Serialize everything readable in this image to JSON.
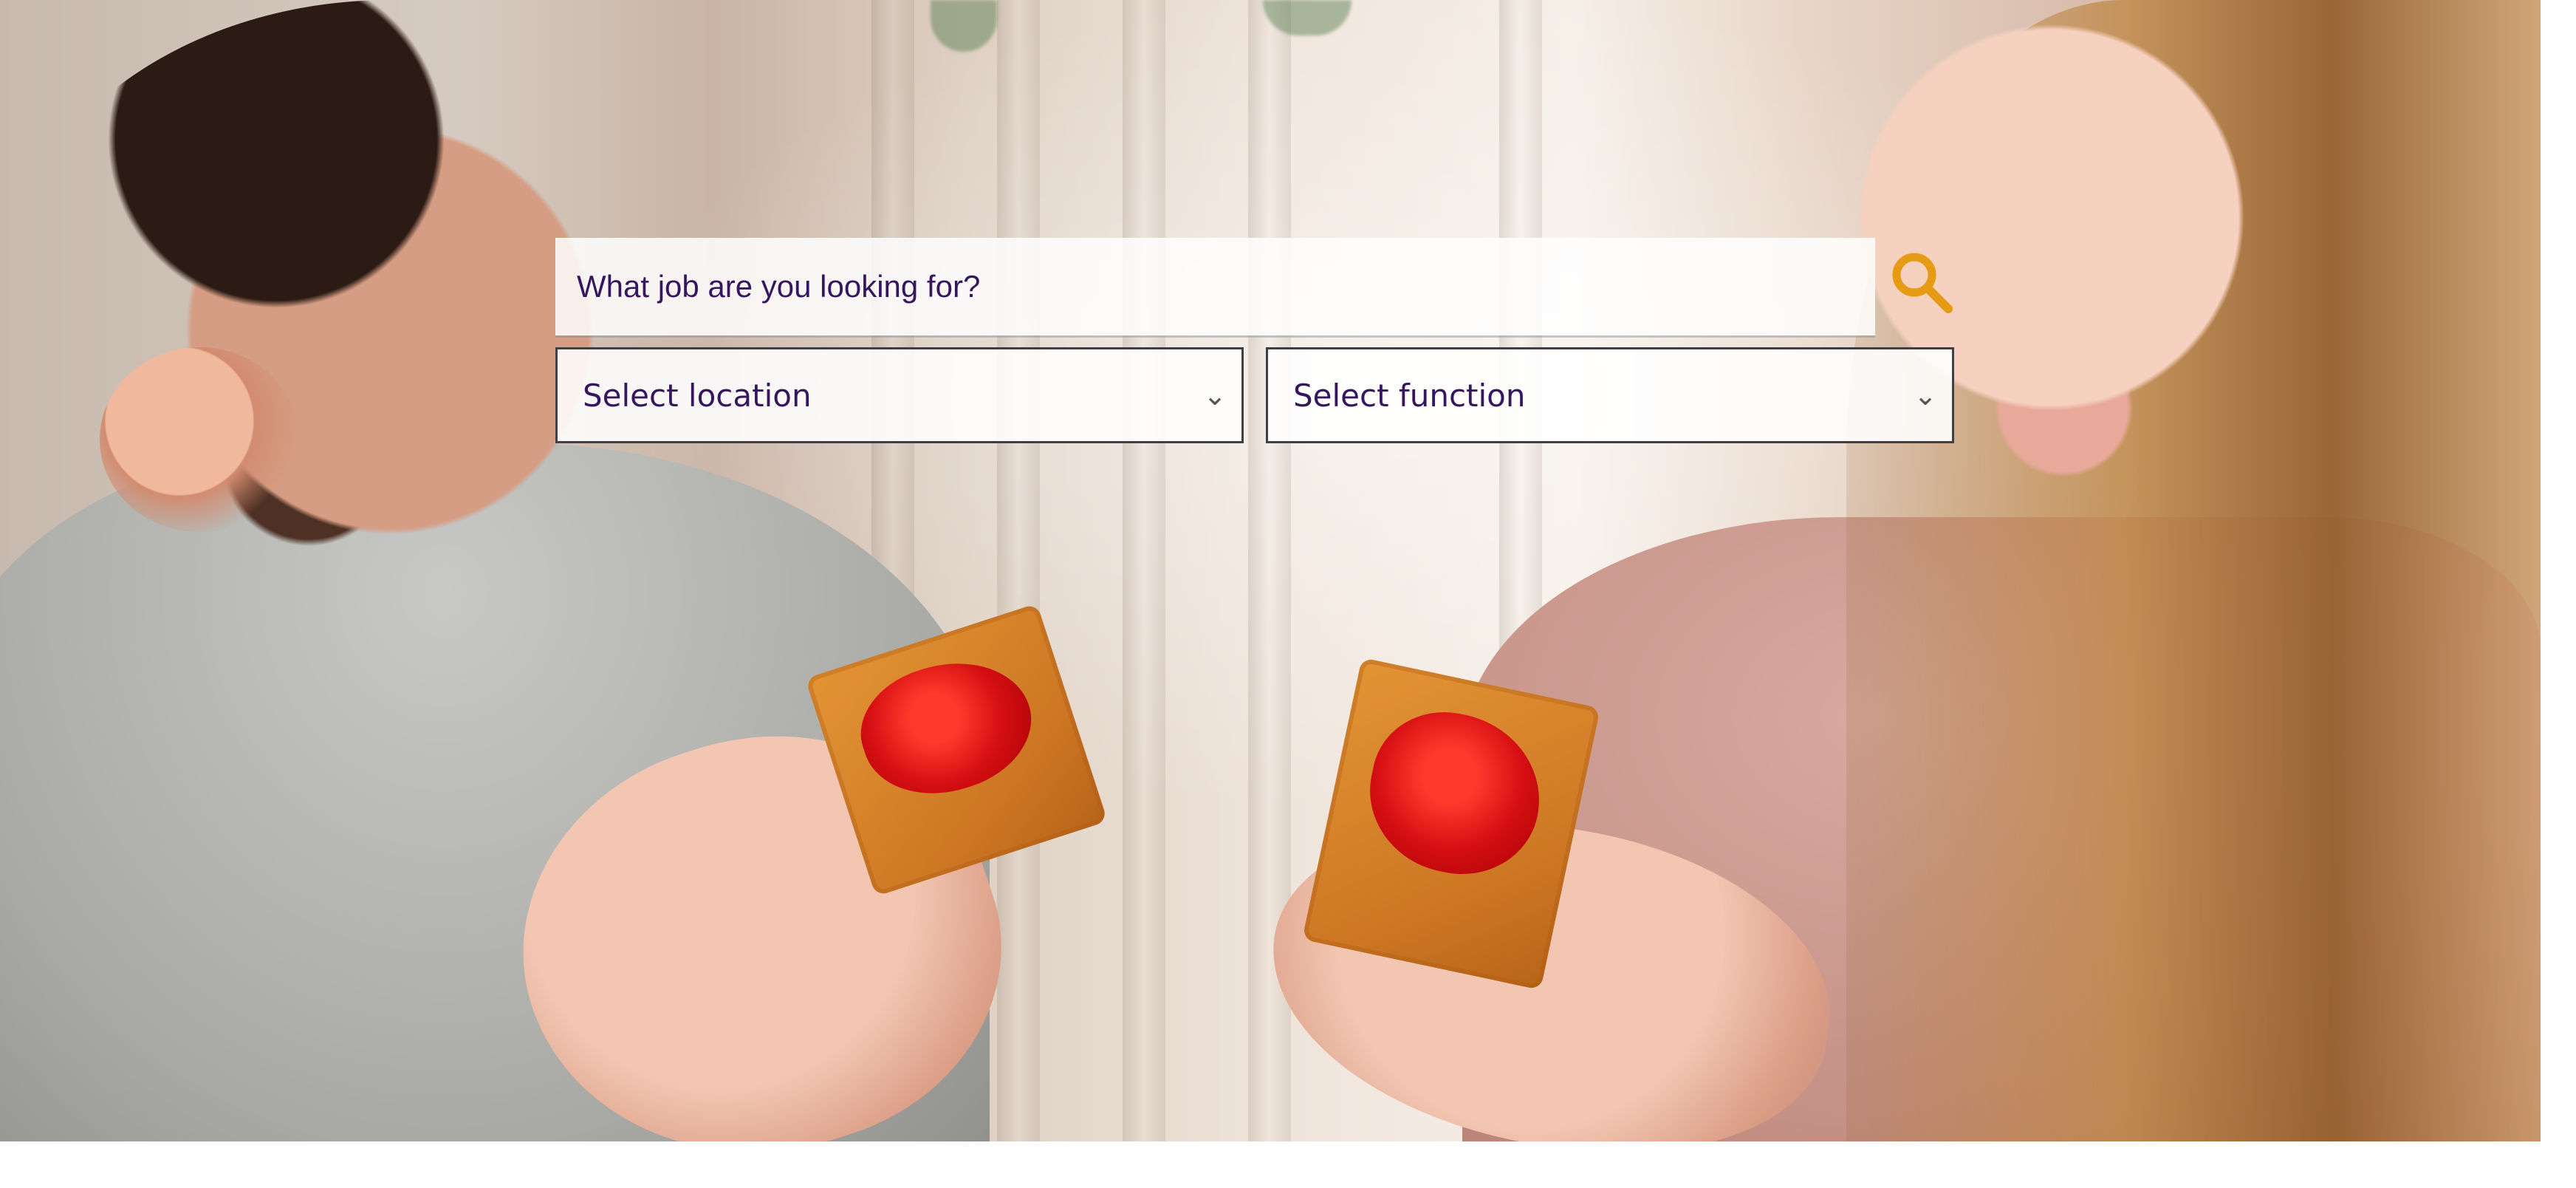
{
  "search": {
    "placeholder": "What job are you looking for?",
    "button_icon": "magnifying-glass-icon",
    "accent_color": "#e59b13"
  },
  "filters": {
    "location": {
      "selected": "Select location",
      "options": [
        "Select location"
      ]
    },
    "function": {
      "selected": "Select function",
      "options": [
        "Select function"
      ]
    }
  },
  "colors": {
    "text": "#35165f",
    "field_background": "#f8f5f4",
    "select_border": "#3f3f46"
  }
}
